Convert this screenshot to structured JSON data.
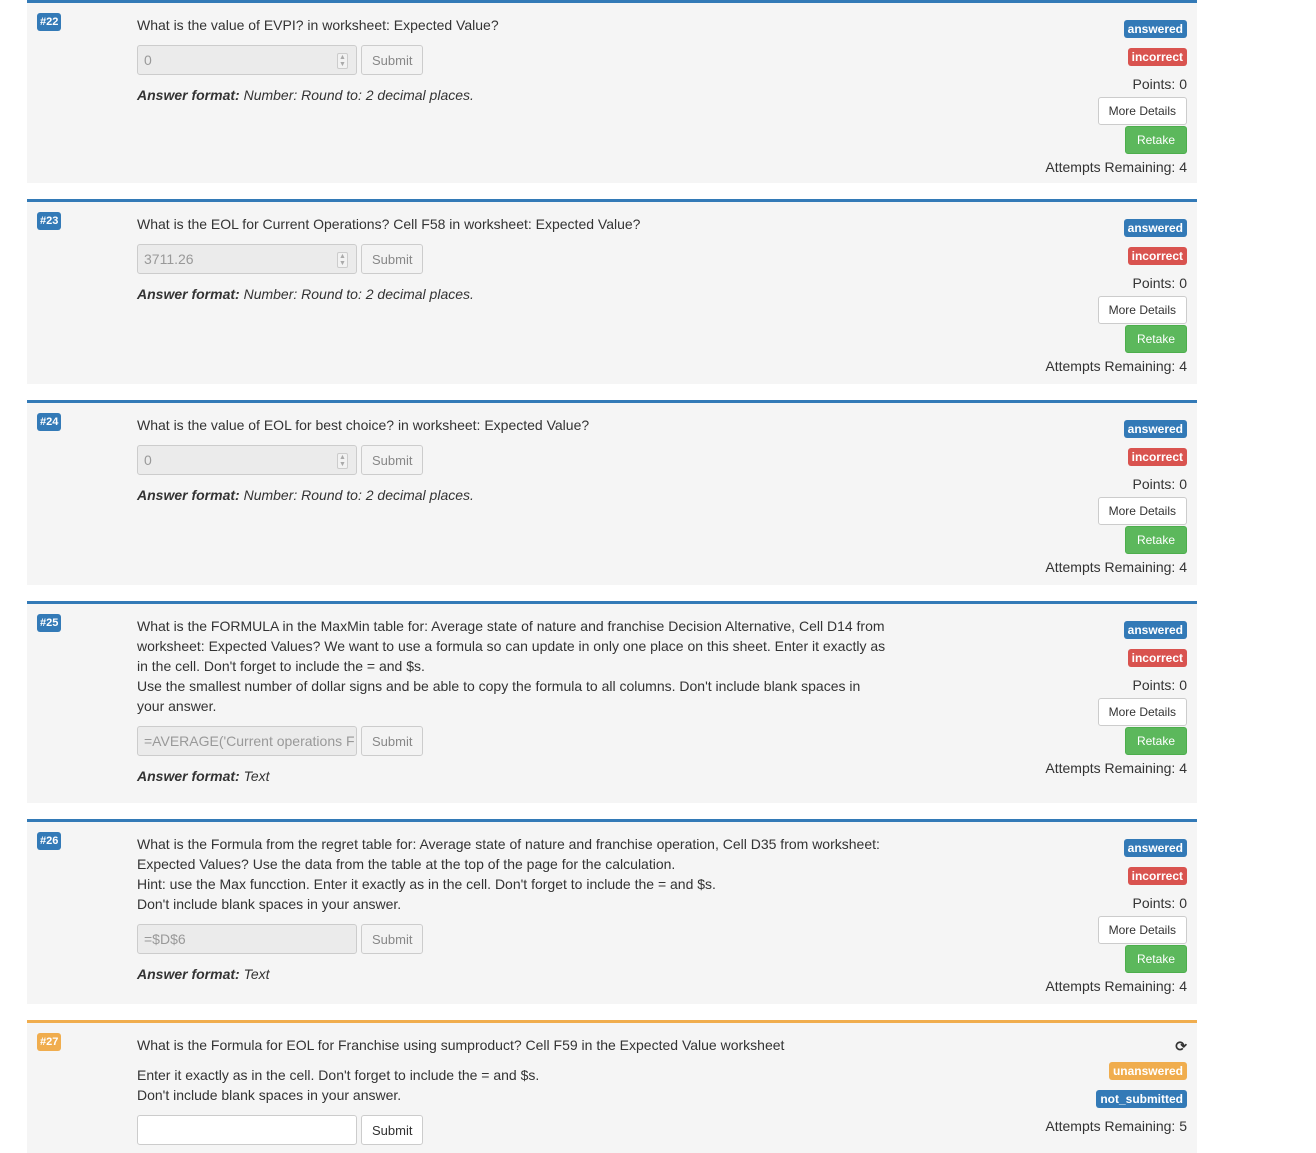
{
  "questions": [
    {
      "number": "#22",
      "text": [
        "What is the value of EVPI? in worksheet: Expected Value?"
      ],
      "input_value": "0",
      "spinner": true,
      "submit_label": "Submit",
      "format_label": "Answer format:",
      "format_value": "Number: Round to: 2 decimal places.",
      "status_badge": "answered",
      "result_badge": "incorrect",
      "points": "Points: 0",
      "more_details_label": "More Details",
      "retake_label": "Retake",
      "attempts": "Attempts Remaining: 4"
    },
    {
      "number": "#23",
      "text": [
        "What is the EOL for Current Operations? Cell F58 in worksheet: Expected Value?"
      ],
      "input_value": "3711.26",
      "spinner": true,
      "submit_label": "Submit",
      "format_label": "Answer format:",
      "format_value": "Number: Round to: 2 decimal places.",
      "status_badge": "answered",
      "result_badge": "incorrect",
      "points": "Points: 0",
      "more_details_label": "More Details",
      "retake_label": "Retake",
      "attempts": "Attempts Remaining: 4"
    },
    {
      "number": "#24",
      "text": [
        "What is the value of EOL for best choice? in worksheet: Expected Value?"
      ],
      "input_value": "0",
      "spinner": true,
      "submit_label": "Submit",
      "format_label": "Answer format:",
      "format_value": "Number: Round to: 2 decimal places.",
      "status_badge": "answered",
      "result_badge": "incorrect",
      "points": "Points: 0",
      "more_details_label": "More Details",
      "retake_label": "Retake",
      "attempts": "Attempts Remaining: 4"
    },
    {
      "number": "#25",
      "text": [
        "What is the FORMULA in the MaxMin table for: Average state of nature and franchise Decision Alternative, Cell D14 from worksheet: Expected Values? We want to use a formula so can update in only one place on this sheet. Enter it exactly as in the cell. Don't forget to include the = and $s.",
        "Use the smallest number of dollar signs and be able to copy the formula to all columns. Don't include blank spaces in your answer."
      ],
      "input_value": "=AVERAGE('Current operations F",
      "spinner": false,
      "submit_label": "Submit",
      "format_label": "Answer format:",
      "format_value": "Text",
      "status_badge": "answered",
      "result_badge": "incorrect",
      "points": "Points: 0",
      "more_details_label": "More Details",
      "retake_label": "Retake",
      "attempts": "Attempts Remaining: 4"
    },
    {
      "number": "#26",
      "text": [
        "What is the Formula from the regret table for: Average state of nature and franchise operation, Cell D35 from worksheet: Expected Values? Use the data from the table at the top of the page for the calculation.",
        "Hint: use the Max funcction. Enter it exactly as in the cell. Don't forget to include the = and $s.",
        "Don't include blank spaces in your answer."
      ],
      "input_value": "=$D$6",
      "spinner": false,
      "submit_label": "Submit",
      "format_label": "Answer format:",
      "format_value": "Text",
      "status_badge": "answered",
      "result_badge": "incorrect",
      "points": "Points: 0",
      "more_details_label": "More Details",
      "retake_label": "Retake",
      "attempts": "Attempts Remaining: 4"
    },
    {
      "number": "#27",
      "text": [
        "What is the Formula for EOL for Franchise using sumproduct? Cell F59 in the Expected Value worksheet",
        "Enter it exactly as in the cell. Don't forget to include the = and $s.",
        "Don't include blank spaces in your answer."
      ],
      "input_value": "",
      "submit_label": "Submit",
      "status_badge": "unanswered",
      "submission_badge": "not_submitted",
      "refresh_icon": "refresh-icon",
      "attempts": "Attempts Remaining: 5"
    }
  ],
  "colors": {
    "primary": "#337ab7",
    "danger": "#d9534f",
    "success": "#5cb85c",
    "warning": "#f0ad4e"
  }
}
